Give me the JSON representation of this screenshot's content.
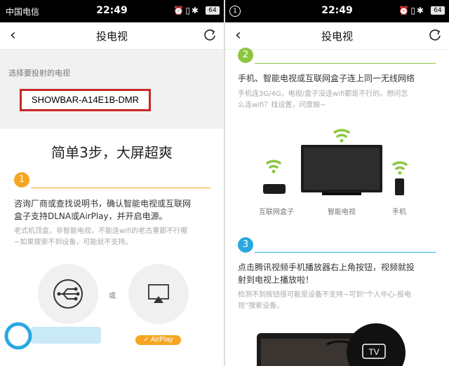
{
  "left": {
    "status": {
      "carrier": "中国电信",
      "time": "22:49",
      "icons": "⏰▯✱",
      "battery": "64"
    },
    "nav": {
      "title": "投电视"
    },
    "select_label": "选择要投射的电视",
    "device_name": "SHOWBAR-A14E1B-DMR",
    "headline": "简单3步，大屏超爽",
    "step1": {
      "num": "1",
      "line1": "咨询厂商或查找说明书，确认智能电视或互联网",
      "line2": "盒子支持DLNA或AirPlay，并开启电源。",
      "sub1": "老式机顶盒，非智能电视，不能连wifi的老古董都不行喔",
      "sub2": "~如果搜索不到设备，可能就不支持。"
    },
    "or_text": "或",
    "airplay_label": "✓ AirPlay"
  },
  "right": {
    "status": {
      "notif": "1",
      "time": "22:49",
      "icons": "⏰▯✱",
      "battery": "64"
    },
    "nav": {
      "title": "投电视"
    },
    "step2": {
      "num": "2",
      "line1": "手机、智能电视或互联网盒子连上同一无线网络",
      "sub1": "手机连3G/4G，电视/盒子没连wifi都是不行的。想问怎",
      "sub2": "么连wifi？找设置，问度娘~"
    },
    "device_labels": {
      "box": "互联网盒子",
      "tv": "智能电视",
      "phone": "手机"
    },
    "step3": {
      "num": "3",
      "line1": "点击腾讯视频手机播放器右上角按钮，视频就投",
      "line2": "射到电视上播放啦！",
      "sub1": "检测不到按钮很可能是设备不支持~可到“个人中心-投电",
      "sub2": "视”搜索设备。"
    },
    "tv_badge": "TV"
  },
  "colors": {
    "accent_orange": "#f5a623",
    "accent_blue": "#29a8e0",
    "wifi_green": "#8cc63f",
    "highlight_red": "#c62828"
  }
}
